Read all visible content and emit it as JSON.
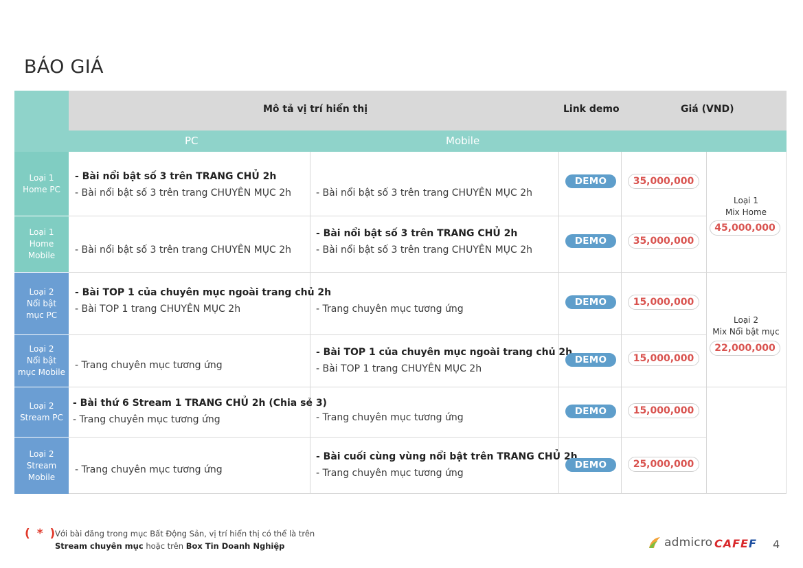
{
  "page": {
    "title": "BÁO GIÁ",
    "page_number": "4"
  },
  "table": {
    "header": {
      "description": "Mô tả vị trí hiển thị",
      "link_demo": "Link demo",
      "price": "Giá (VND)"
    },
    "subheader": {
      "pc": "PC",
      "mobile": "Mobile"
    },
    "rows": [
      {
        "label": "Loại 1\nHome PC",
        "pc_bold": "- Bài nổi bật số 3 trên TRANG CHỦ 2h",
        "pc_line": "- Bài nổi bật số 3 trên trang CHUYÊN MỤC 2h",
        "mobile_bold": "",
        "mobile_line": "- Bài nổi bật số 3 trên trang CHUYÊN MỤC 2h",
        "demo": "DEMO",
        "price": "35,000,000"
      },
      {
        "label": "Loại 1\nHome\nMobile",
        "pc_bold": "",
        "pc_line": "- Bài nổi bật số 3 trên trang CHUYÊN MỤC 2h",
        "mobile_bold": "- Bài nổi bật số 3 trên TRANG CHỦ 2h",
        "mobile_line": "- Bài nổi bật số 3 trên trang CHUYÊN MỤC 2h",
        "demo": "DEMO",
        "price": "35,000,000"
      },
      {
        "label": "Loại 2\nNổi bật\nmục PC",
        "pc_bold": "- Bài TOP 1 của chuyên mục ngoài trang chủ 2h",
        "pc_line": "- Bài TOP 1 trang CHUYÊN MỤC 2h",
        "mobile_bold": "",
        "mobile_line": "- Trang chuyên mục tương ứng",
        "demo": "DEMO",
        "price": "15,000,000"
      },
      {
        "label": "Loại 2\nNổi bật\nmục Mobile",
        "pc_bold": "",
        "pc_line": "- Trang chuyên mục tương ứng",
        "mobile_bold": "- Bài TOP 1 của chuyên mục ngoài trang chủ 2h",
        "mobile_line": "- Bài TOP 1 trang CHUYÊN MỤC 2h",
        "demo": "DEMO",
        "price": "15,000,000"
      },
      {
        "label": "Loại 2\nStream PC",
        "pc_bold": "- Bài thứ 6 Stream 1 TRANG CHỦ 2h (Chia sẻ 3)",
        "pc_line": "- Trang chuyên mục tương ứng",
        "mobile_bold": "",
        "mobile_line": "- Trang chuyên mục tương ứng",
        "demo": "DEMO",
        "price": "15,000,000"
      },
      {
        "label": "Loại 2\nStream\nMobile",
        "pc_bold": "",
        "pc_line": "- Trang chuyên mục tương ứng",
        "mobile_bold": "- Bài cuối cùng vùng nổi bật trên TRANG CHỦ 2h",
        "mobile_line": "- Trang chuyên mục tương ứng",
        "demo": "DEMO",
        "price": "25,000,000"
      }
    ],
    "mix": [
      {
        "label": "Loại 1\nMix Home",
        "price": "45,000,000"
      },
      {
        "label": "Loại 2\nMix Nổi bật mục",
        "price": "22,000,000"
      }
    ]
  },
  "footnote": {
    "mark": "( * )",
    "line1": "Với bài đăng trong mục Bất Động Sản, vị trí hiển thị có thể là trên",
    "line2_bold1": "Stream chuyên mục",
    "line2_mid": " hoặc trên ",
    "line2_bold2": "Box Tin Doanh Nghiệp"
  },
  "brand": {
    "admicro": "admicro",
    "cafef_part1": "CAFE",
    "cafef_part2": "F"
  },
  "colors": {
    "teal": "#80cdc2",
    "blue": "#6b9ed3",
    "demo_button": "#5e9ecb",
    "price_red": "#d9534f"
  }
}
